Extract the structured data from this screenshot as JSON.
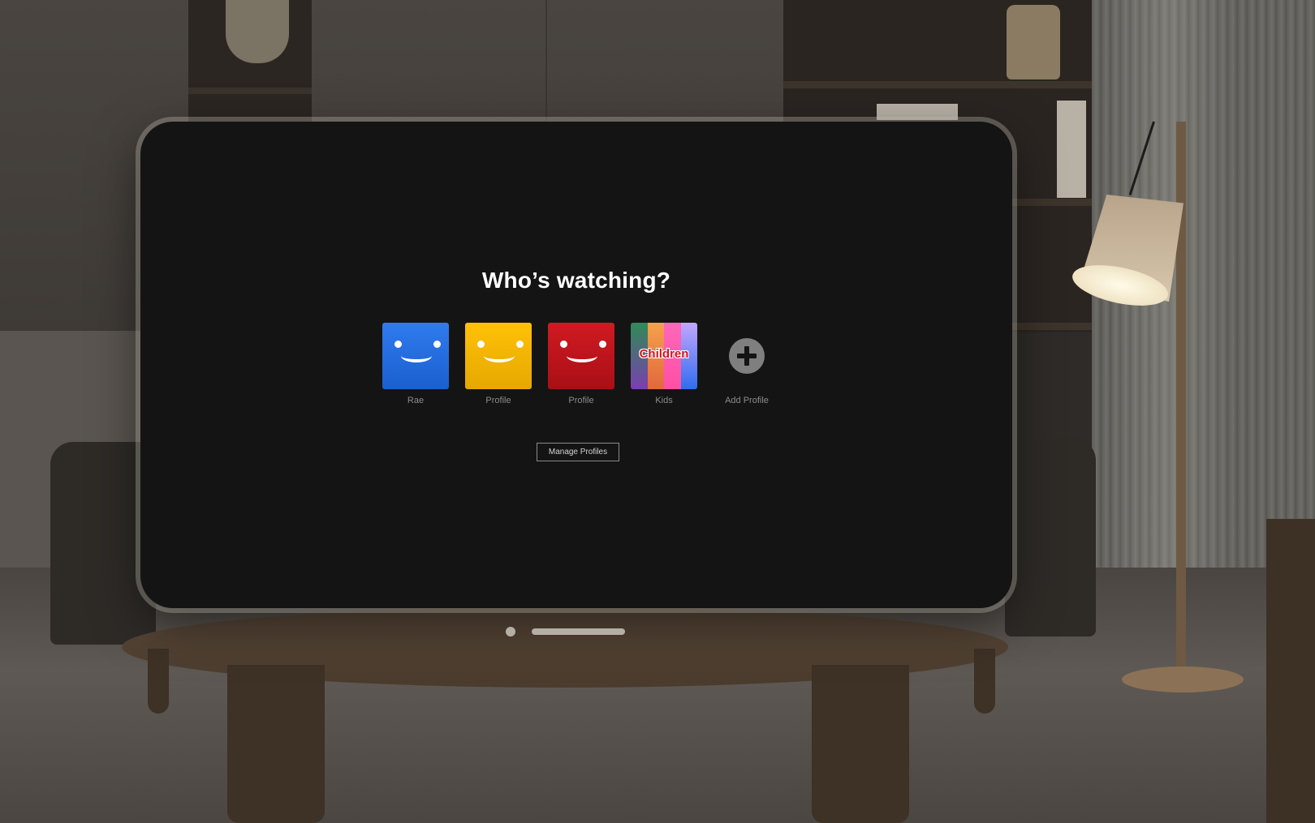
{
  "screen": {
    "title": "Who’s watching?",
    "profiles": [
      {
        "name": "Rae",
        "icon": "smiley-avatar-icon",
        "color": "#1f65d6"
      },
      {
        "name": "Profile",
        "icon": "smiley-avatar-icon",
        "color": "#f2b200"
      },
      {
        "name": "Profile",
        "icon": "smiley-avatar-icon",
        "color": "#c0141b"
      },
      {
        "name": "Kids",
        "icon": "children-avatar-icon",
        "badge": "Children"
      }
    ],
    "add_profile": {
      "label": "Add Profile",
      "icon": "plus-circle-icon"
    },
    "manage_button": "Manage Profiles"
  },
  "window_controls": {
    "icons": [
      "window-dot-icon",
      "window-grab-bar-icon"
    ]
  }
}
